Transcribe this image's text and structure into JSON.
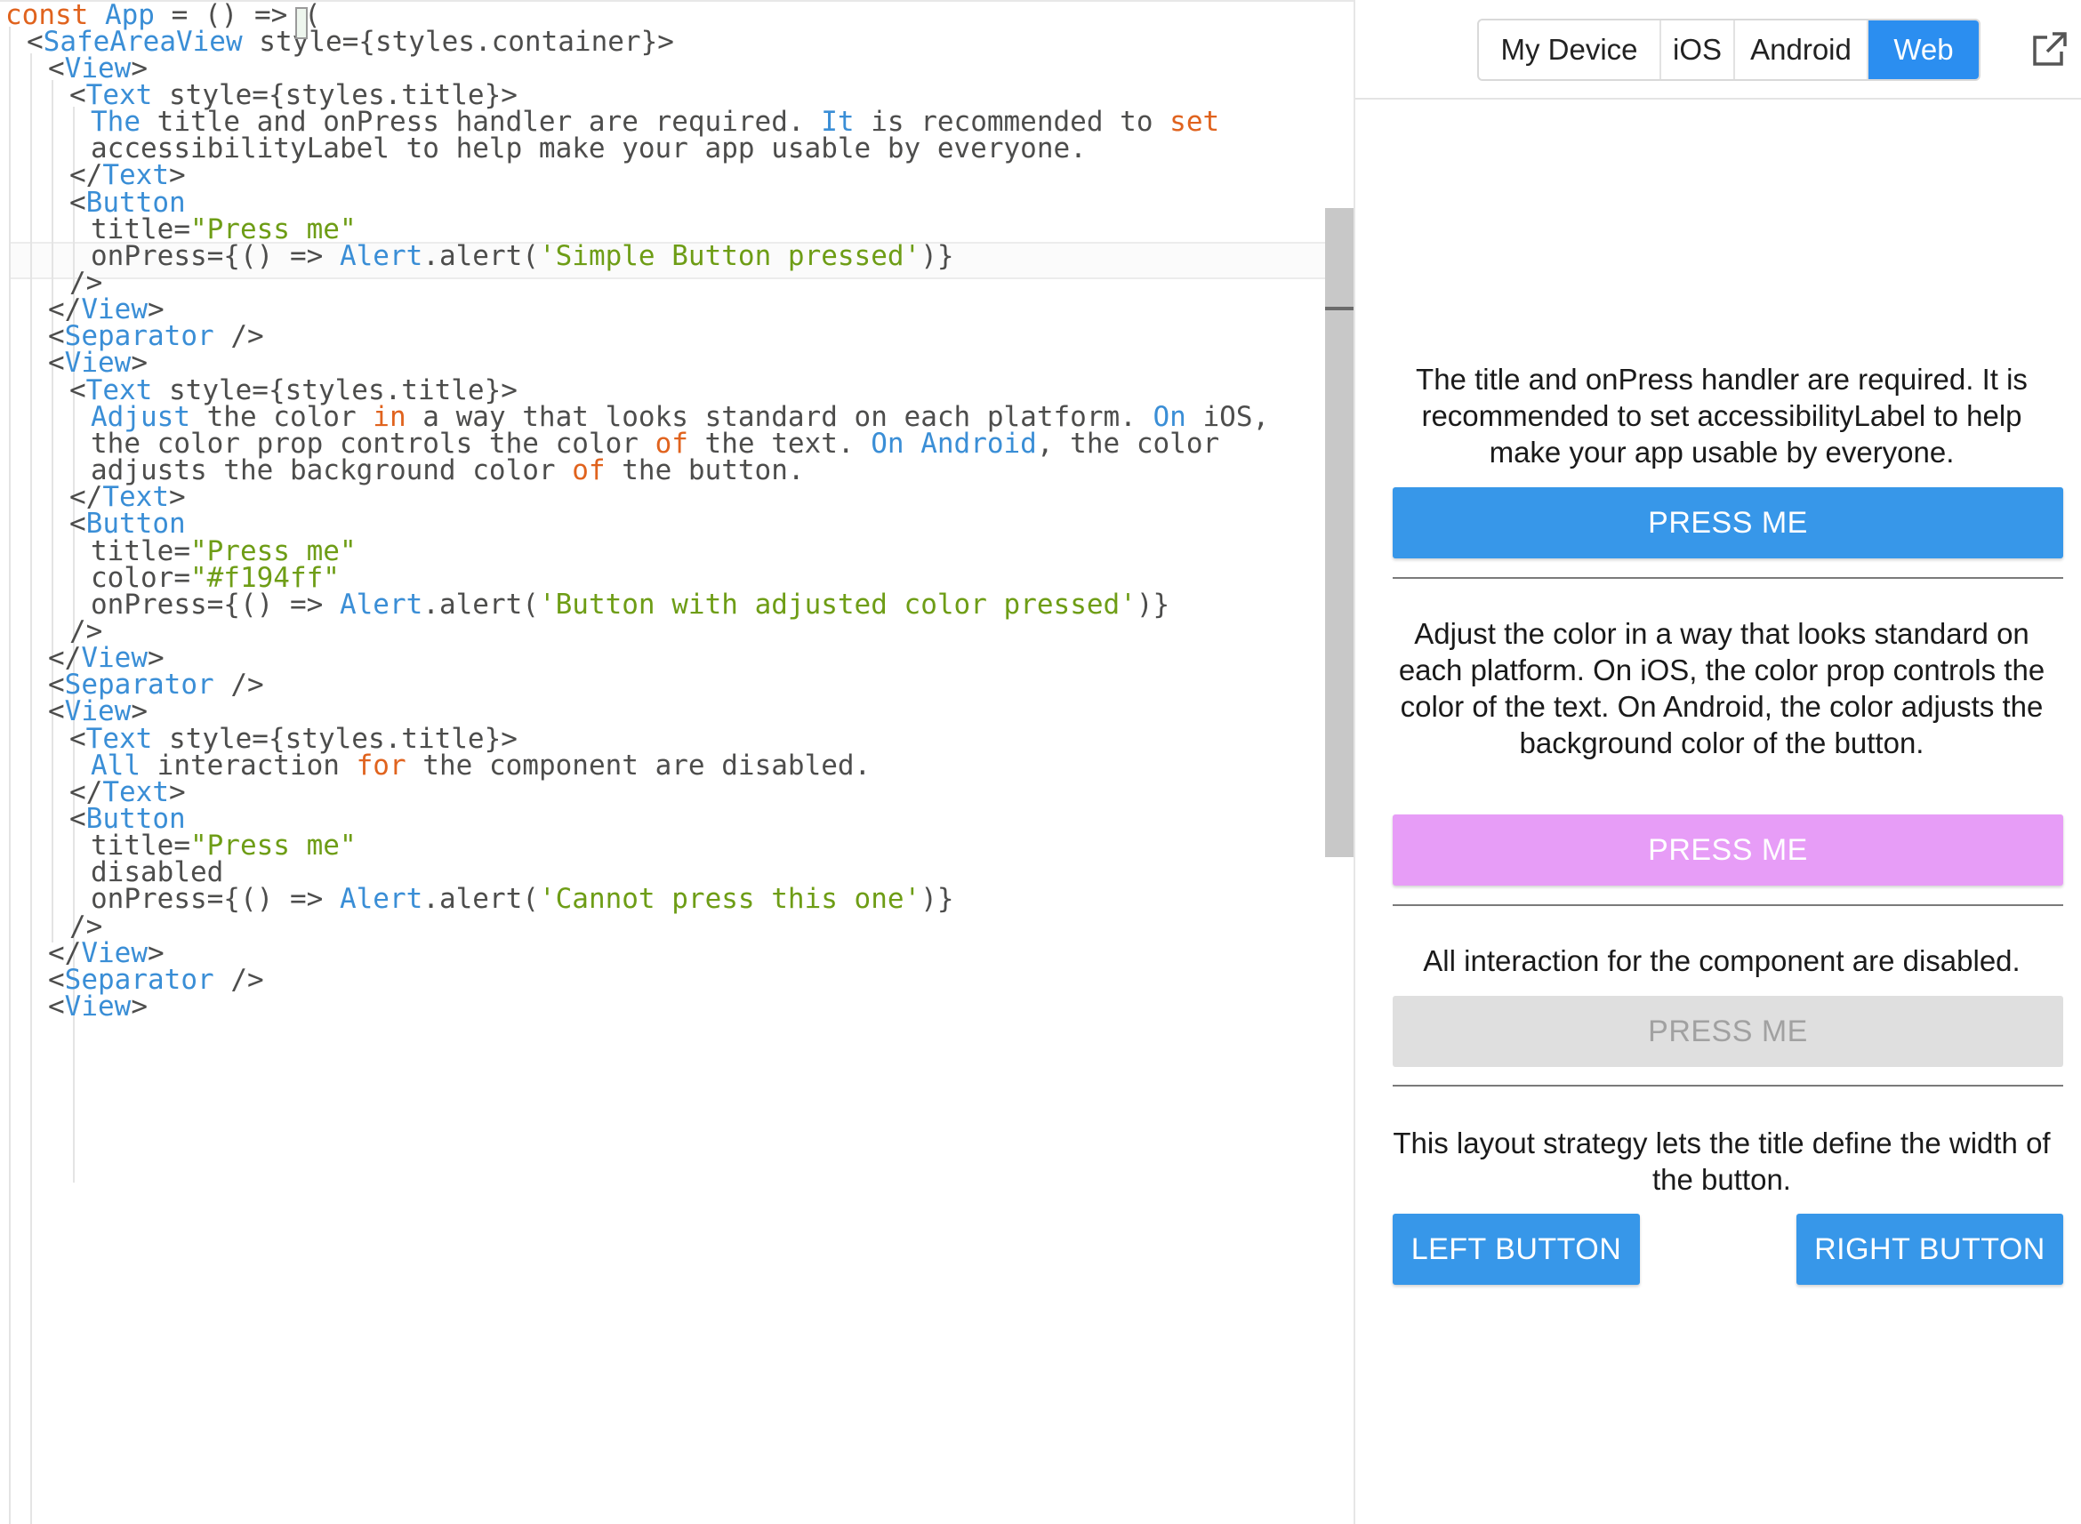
{
  "colors": {
    "keyword": "#e0631e",
    "tag": "#3a8ed6",
    "string": "#6e9d16",
    "plain": "#4d4d4c",
    "web_blue": "#2b8ef0",
    "button_blue": "#3797e9",
    "button_pink": "#e79df7",
    "button_disabled_bg": "#dfdfdf",
    "button_disabled_text": "#a1a1a1"
  },
  "editor": {
    "lines": [
      [
        [
          "k",
          "const "
        ],
        [
          "t",
          "App"
        ],
        [
          "p",
          " = () => ("
        ]
      ],
      [
        [
          "p",
          "<"
        ],
        [
          "t",
          "SafeAreaView"
        ],
        [
          "p",
          " style={styles.container}>"
        ]
      ],
      [
        [
          "p",
          "<"
        ],
        [
          "t",
          "View"
        ],
        [
          "p",
          ">"
        ]
      ],
      [
        [
          "p",
          "<"
        ],
        [
          "t",
          "Text"
        ],
        [
          "p",
          " style={styles.title}>"
        ]
      ],
      [
        [
          "t",
          "The"
        ],
        [
          "p",
          " title and onPress handler are required. "
        ],
        [
          "t",
          "It"
        ],
        [
          "p",
          " is recommended to "
        ],
        [
          "k",
          "set"
        ]
      ],
      [
        [
          "p",
          "accessibilityLabel to help make your app usable by everyone."
        ]
      ],
      [
        [
          "p",
          "</"
        ],
        [
          "t",
          "Text"
        ],
        [
          "p",
          ">"
        ]
      ],
      [
        [
          "p",
          "<"
        ],
        [
          "t",
          "Button"
        ]
      ],
      [
        [
          "p",
          "title="
        ],
        [
          "s",
          "\"Press me\""
        ]
      ],
      [
        [
          "p",
          "onPress={() => "
        ],
        [
          "t",
          "Alert"
        ],
        [
          "p",
          ".alert("
        ],
        [
          "s",
          "'Simple Button pressed'"
        ],
        [
          "p",
          ")}"
        ]
      ],
      [
        [
          "p",
          "/>"
        ]
      ],
      [
        [
          "p",
          "</"
        ],
        [
          "t",
          "View"
        ],
        [
          "p",
          ">"
        ]
      ],
      [
        [
          "p",
          "<"
        ],
        [
          "t",
          "Separator"
        ],
        [
          "p",
          " />"
        ]
      ],
      [
        [
          "p",
          "<"
        ],
        [
          "t",
          "View"
        ],
        [
          "p",
          ">"
        ]
      ],
      [
        [
          "p",
          "<"
        ],
        [
          "t",
          "Text"
        ],
        [
          "p",
          " style={styles.title}>"
        ]
      ],
      [
        [
          "t",
          "Adjust"
        ],
        [
          "p",
          " the color "
        ],
        [
          "k",
          "in"
        ],
        [
          "p",
          " a way that looks standard on each platform. "
        ],
        [
          "t",
          "On"
        ],
        [
          "p",
          " iOS,"
        ]
      ],
      [
        [
          "p",
          "the color prop controls the color "
        ],
        [
          "k",
          "of"
        ],
        [
          "p",
          " the text. "
        ],
        [
          "t",
          "On"
        ],
        [
          "p",
          " "
        ],
        [
          "t",
          "Android"
        ],
        [
          "p",
          ", the color"
        ]
      ],
      [
        [
          "p",
          "adjusts the background color "
        ],
        [
          "k",
          "of"
        ],
        [
          "p",
          " the button."
        ]
      ],
      [
        [
          "p",
          "</"
        ],
        [
          "t",
          "Text"
        ],
        [
          "p",
          ">"
        ]
      ],
      [
        [
          "p",
          "<"
        ],
        [
          "t",
          "Button"
        ]
      ],
      [
        [
          "p",
          "title="
        ],
        [
          "s",
          "\"Press me\""
        ]
      ],
      [
        [
          "p",
          "color="
        ],
        [
          "s",
          "\"#f194ff\""
        ]
      ],
      [
        [
          "p",
          "onPress={() => "
        ],
        [
          "t",
          "Alert"
        ],
        [
          "p",
          ".alert("
        ],
        [
          "s",
          "'Button with adjusted color pressed'"
        ],
        [
          "p",
          ")}"
        ]
      ],
      [
        [
          "p",
          "/>"
        ]
      ],
      [
        [
          "p",
          "</"
        ],
        [
          "t",
          "View"
        ],
        [
          "p",
          ">"
        ]
      ],
      [
        [
          "p",
          "<"
        ],
        [
          "t",
          "Separator"
        ],
        [
          "p",
          " />"
        ]
      ],
      [
        [
          "p",
          "<"
        ],
        [
          "t",
          "View"
        ],
        [
          "p",
          ">"
        ]
      ],
      [
        [
          "p",
          "<"
        ],
        [
          "t",
          "Text"
        ],
        [
          "p",
          " style={styles.title}>"
        ]
      ],
      [
        [
          "t",
          "All"
        ],
        [
          "p",
          " interaction "
        ],
        [
          "k",
          "for"
        ],
        [
          "p",
          " the component are disabled."
        ]
      ],
      [
        [
          "p",
          "</"
        ],
        [
          "t",
          "Text"
        ],
        [
          "p",
          ">"
        ]
      ],
      [
        [
          "p",
          "<"
        ],
        [
          "t",
          "Button"
        ]
      ],
      [
        [
          "p",
          "title="
        ],
        [
          "s",
          "\"Press me\""
        ]
      ],
      [
        [
          "p",
          "disabled"
        ]
      ],
      [
        [
          "p",
          "onPress={() => "
        ],
        [
          "t",
          "Alert"
        ],
        [
          "p",
          ".alert("
        ],
        [
          "s",
          "'Cannot press this one'"
        ],
        [
          "p",
          ")}"
        ]
      ],
      [
        [
          "p",
          "/>"
        ]
      ],
      [
        [
          "p",
          "</"
        ],
        [
          "t",
          "View"
        ],
        [
          "p",
          ">"
        ]
      ],
      [
        [
          "p",
          "<"
        ],
        [
          "t",
          "Separator"
        ],
        [
          "p",
          " />"
        ]
      ],
      [
        [
          "p",
          "<"
        ],
        [
          "t",
          "View"
        ],
        [
          "p",
          ">"
        ]
      ]
    ]
  },
  "preview": {
    "tabs": [
      {
        "label": "My Device",
        "active": false
      },
      {
        "label": "iOS",
        "active": false
      },
      {
        "label": "Android",
        "active": false
      },
      {
        "label": "Web",
        "active": true
      }
    ],
    "external_icon": "external-link-icon",
    "section1_text": "The title and onPress handler are required. It is recommended to set accessibilityLabel to help make your app usable by everyone.",
    "section1_button": "PRESS ME",
    "section2_text": "Adjust the color in a way that looks standard on each platform. On iOS, the color prop controls the color of the text. On Android, the color adjusts the background color of the button.",
    "section2_button": "PRESS ME",
    "section3_text": "All interaction for the component are disabled.",
    "section3_button": "PRESS ME",
    "section4_text": "This layout strategy lets the title define the width of the button.",
    "left_button": "LEFT BUTTON",
    "right_button": "RIGHT BUTTON"
  }
}
